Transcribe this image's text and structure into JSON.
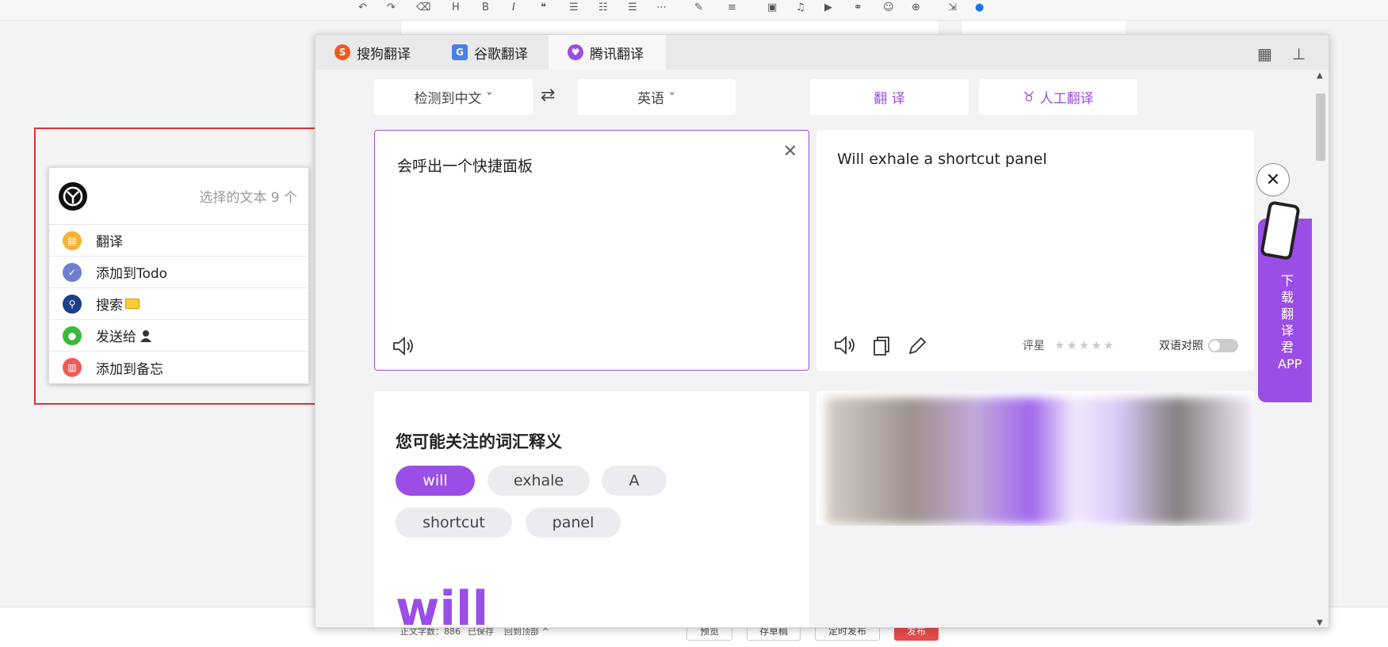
{
  "quick_panel": {
    "selected_text": "选择的文本 9 个",
    "items": [
      {
        "label": "翻译",
        "icon": "translate-icon",
        "color": "#f5b335"
      },
      {
        "label": "添加到Todo",
        "icon": "check-icon",
        "color": "#6c7fd0"
      },
      {
        "label": "搜索",
        "icon": "search-icon",
        "color": "#1a3f8c"
      },
      {
        "label": "发送给",
        "icon": "wechat-icon",
        "color": "#3cb93a"
      },
      {
        "label": "添加到备忘",
        "icon": "memo-icon",
        "color": "#ee5a5a"
      }
    ]
  },
  "translator": {
    "tabs": [
      {
        "label": "搜狗翻译",
        "icon": "sogou-icon",
        "color": "#f05a22"
      },
      {
        "label": "谷歌翻译",
        "icon": "google-translate-icon",
        "color": "#4a7ee8"
      },
      {
        "label": "腾讯翻译",
        "icon": "tencent-icon",
        "color": "#9b4ee6"
      }
    ],
    "source_lang": "检测到中文 ˇ",
    "target_lang": "英语 ˇ",
    "translate_btn": "翻 译",
    "human_translate_btn": "人工翻译",
    "source_text": "会呼出一个快捷面板",
    "target_text": "Will exhale a shortcut panel",
    "rating_label": "评星",
    "bilingual_label": "双语对照",
    "vocab_title": "您可能关注的词汇释义",
    "vocab_chips": [
      "will",
      "exhale",
      "A",
      "shortcut",
      "panel"
    ],
    "selected_word": "will",
    "side_app_label": "下载翻译君APP",
    "accent": "#9b4ee6"
  },
  "footer": {
    "word_count": "正文字数：886",
    "saved": "已保存",
    "back_top": "回到顶部 ^",
    "buttons": [
      "预览",
      "存草稿",
      "定时发布",
      "发布"
    ]
  }
}
